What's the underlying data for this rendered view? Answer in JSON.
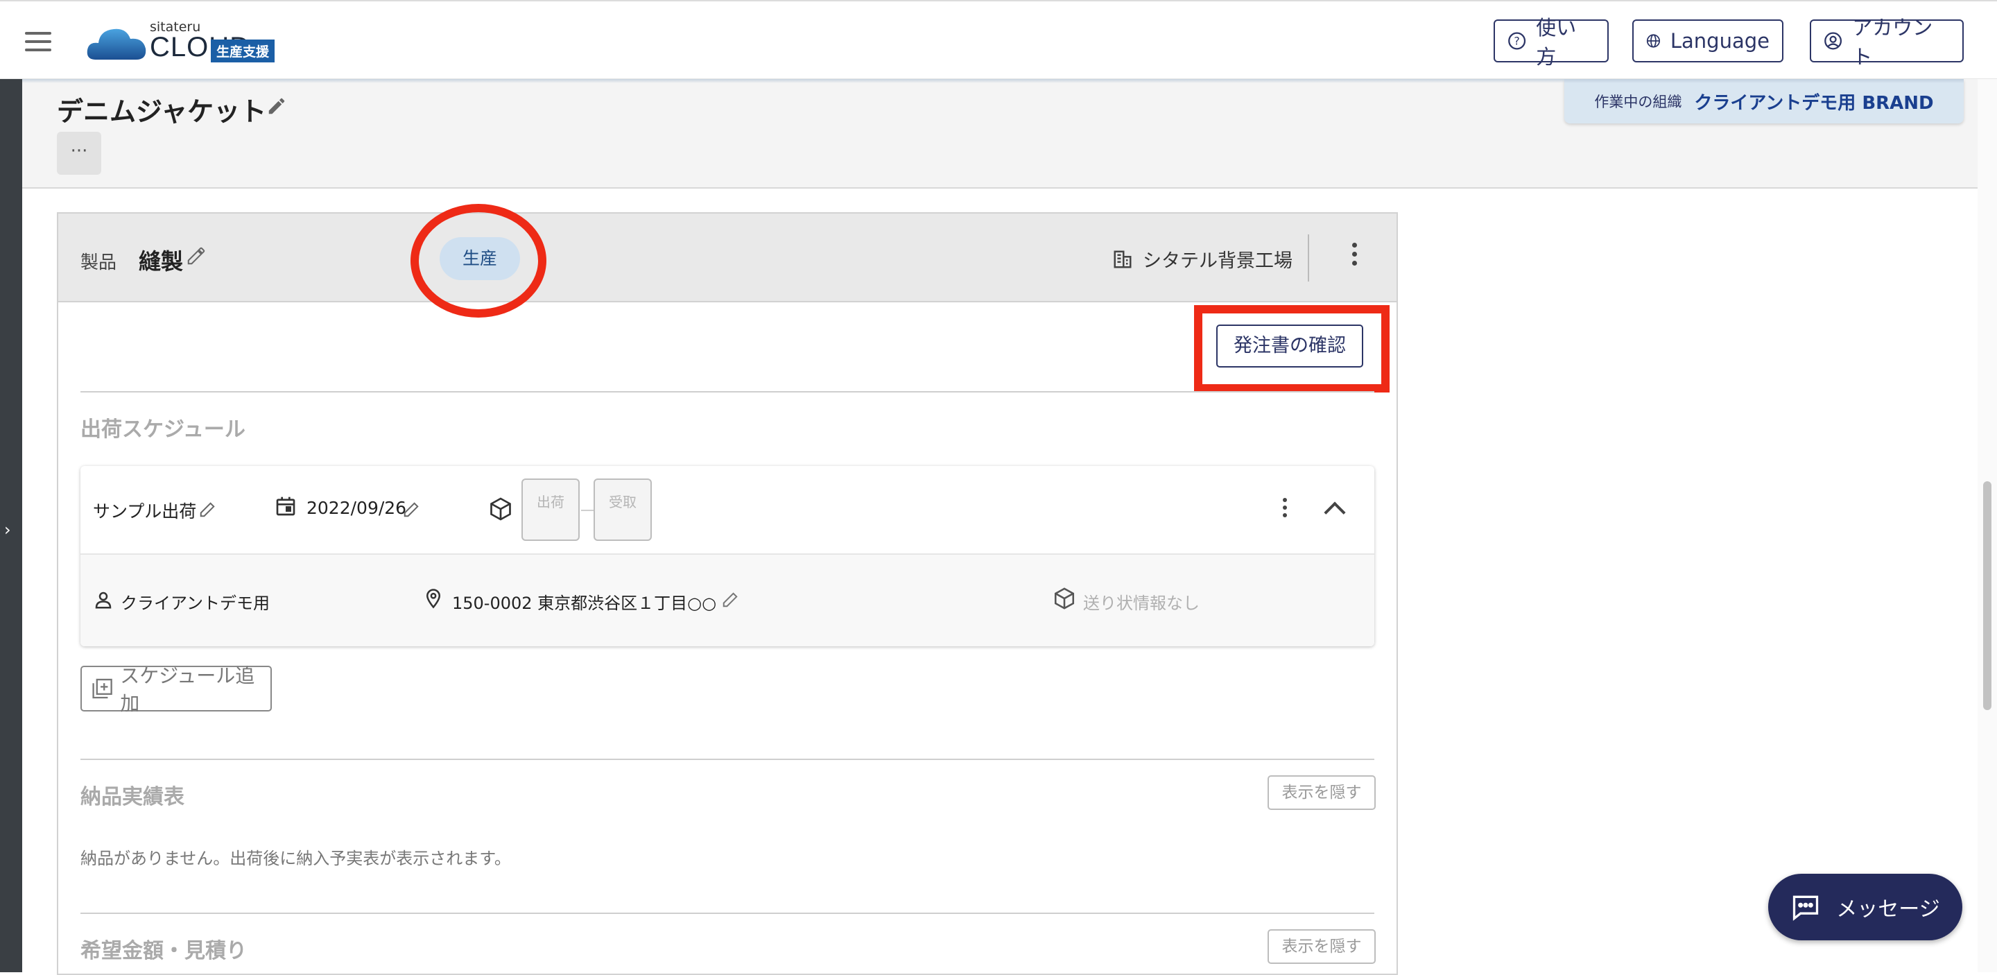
{
  "header": {
    "logo_small": "sitateru",
    "logo_main": "CLOUD",
    "logo_badge": "生産支援",
    "help_label": "使い方",
    "language_label": "Language",
    "account_label": "アカウント"
  },
  "page": {
    "title": "デニムジャケット",
    "more_label": "···",
    "org_label": "作業中の組織",
    "org_name": "クライアントデモ用 BRAND"
  },
  "product": {
    "label": "製品",
    "name": "縫製",
    "status": "生産",
    "factory": "シタテル背景工場",
    "po_button": "発注書の確認"
  },
  "shipping": {
    "section_title": "出荷スケジュール",
    "schedule": {
      "name": "サンプル出荷",
      "date": "2022/09/26",
      "step_ship": "出荷",
      "step_receive": "受取",
      "recipient": "クライアントデモ用",
      "address": "150-0002 東京都渋谷区１丁目○○",
      "tracking": "送り状情報なし"
    },
    "add_button": "スケジュール追加"
  },
  "delivery": {
    "section_title": "納品実績表",
    "hide_button": "表示を隠す",
    "empty_message": "納品がありません。出荷後に納入予実表が表示されます。"
  },
  "estimate": {
    "section_title": "希望金額・見積り",
    "hide_button": "表示を隠す"
  },
  "fab": {
    "label": "メッセージ"
  },
  "colors": {
    "accent": "#2c3566",
    "annotation": "#ee2a16",
    "status_chip": "#cfe0f0"
  }
}
